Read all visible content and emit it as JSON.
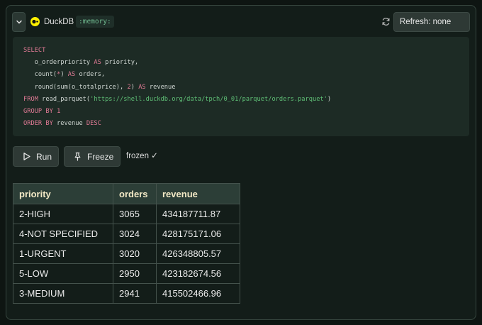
{
  "header": {
    "db_name": "DuckDB",
    "db_badge": ":memory:",
    "refresh_label": "Refresh: none"
  },
  "colors": {
    "duck_yellow": "#fff000",
    "keyword": "#e07a95",
    "string": "#5fbf76",
    "badge_text": "#6fb88e",
    "table_header_text": "#f3e9c6"
  },
  "editor": {
    "l1_kw": "SELECT",
    "l2_a": "o_orderpriority ",
    "l2_kw": "AS",
    "l2_b": " priority,",
    "l3_fn": "count",
    "l3_a": "(",
    "l3_star": "*",
    "l3_b": ") ",
    "l3_kw": "AS",
    "l3_c": " orders,",
    "l4_fn1": "round",
    "l4_a": "(",
    "l4_fn2": "sum",
    "l4_b": "(o_totalprice), ",
    "l4_num": "2",
    "l4_c": ") ",
    "l4_kw": "AS",
    "l4_d": " revenue",
    "l5_kw": "FROM",
    "l5_a": " read_parquet(",
    "l5_str": "'https://shell.duckdb.org/data/tpch/0_01/parquet/orders.parquet'",
    "l5_b": ")",
    "l6_kw": "GROUP BY",
    "l6_sp": " ",
    "l6_num": "1",
    "l7_kw": "ORDER BY",
    "l7_a": " revenue ",
    "l7_kw2": "DESC"
  },
  "actions": {
    "run_label": "Run",
    "freeze_label": "Freeze",
    "frozen_status": "frozen ✓"
  },
  "results": {
    "columns": [
      "priority",
      "orders",
      "revenue"
    ],
    "rows": [
      [
        "2-HIGH",
        "3065",
        "434187711.87"
      ],
      [
        "4-NOT SPECIFIED",
        "3024",
        "428175171.06"
      ],
      [
        "1-URGENT",
        "3020",
        "426348805.57"
      ],
      [
        "5-LOW",
        "2950",
        "423182674.56"
      ],
      [
        "3-MEDIUM",
        "2941",
        "415502466.96"
      ]
    ]
  }
}
